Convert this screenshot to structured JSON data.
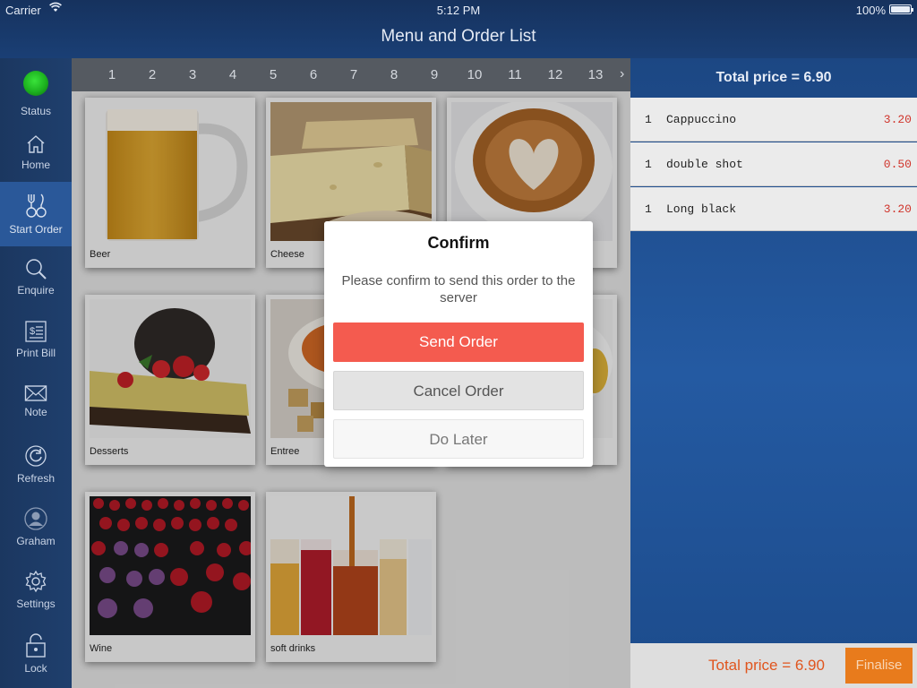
{
  "status_bar": {
    "carrier": "Carrier",
    "time": "5:12 PM",
    "battery": "100%"
  },
  "title": "Menu and Order List",
  "sidebar": {
    "items": [
      {
        "label": "Status",
        "icon": "status-indicator-icon"
      },
      {
        "label": "Home",
        "icon": "home-icon"
      },
      {
        "label": "Start Order",
        "icon": "cutlery-icon"
      },
      {
        "label": "Enquire",
        "icon": "search-icon"
      },
      {
        "label": "Print Bill",
        "icon": "bill-icon"
      },
      {
        "label": "Note",
        "icon": "envelope-icon"
      },
      {
        "label": "Refresh",
        "icon": "refresh-icon"
      },
      {
        "label": "Graham",
        "icon": "user-icon"
      },
      {
        "label": "Settings",
        "icon": "gear-icon"
      },
      {
        "label": "Lock",
        "icon": "lock-icon"
      }
    ],
    "active": "Start Order"
  },
  "pager": {
    "pages": [
      "1",
      "2",
      "3",
      "4",
      "5",
      "6",
      "7",
      "8",
      "9",
      "10",
      "11",
      "12",
      "13"
    ],
    "next": "›"
  },
  "menu": {
    "categories": [
      {
        "label": "Beer"
      },
      {
        "label": "Cheese"
      },
      {
        "label": ""
      },
      {
        "label": "Desserts"
      },
      {
        "label": "Entree"
      },
      {
        "label": ""
      },
      {
        "label": "Wine"
      },
      {
        "label": "soft drinks"
      }
    ]
  },
  "order": {
    "total_top": "Total price = 6.90",
    "items": [
      {
        "qty": "1",
        "name": "Cappuccino",
        "price": "3.20"
      },
      {
        "qty": "1",
        "name": "double shot",
        "price": "0.50"
      },
      {
        "qty": "1",
        "name": "Long black",
        "price": "3.20"
      }
    ],
    "total_bottom": "Total price = 6.90",
    "finalise_label": "Finalise"
  },
  "dialog": {
    "title": "Confirm",
    "message": "Please confirm to send this order to the server",
    "send_label": "Send Order",
    "cancel_label": "Cancel Order",
    "later_label": "Do Later"
  },
  "colors": {
    "accent_red": "#f45b4f",
    "accent_orange": "#e87b1c",
    "status_green": "#1cb11f",
    "price_red": "#d0352c"
  }
}
